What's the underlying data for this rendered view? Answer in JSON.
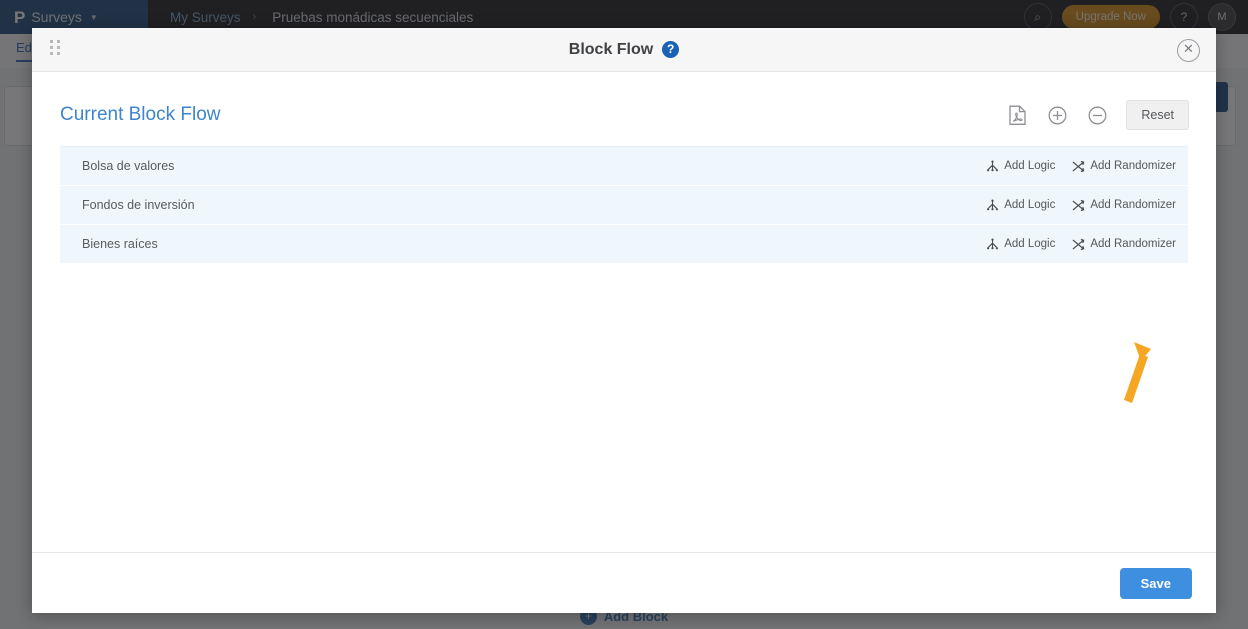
{
  "background": {
    "brand": {
      "logo_glyph": "P",
      "label": "Surveys",
      "caret": "▼"
    },
    "breadcrumb": {
      "parent": "My Surveys",
      "separator": "›",
      "current": "Pruebas monádicas secuenciales"
    },
    "topbar_right": {
      "search_icon": "search-icon",
      "search_glyph": "⌕",
      "upgrade_label": "Upgrade Now",
      "help_glyph": "?",
      "avatar_initial": "M"
    },
    "subtab_label": "Ed",
    "add_block_label": "Add Block",
    "add_block_glyph": "+",
    "accent_blue": "#1f4e86",
    "upgrade_orange": "#d78b10"
  },
  "modal": {
    "header": {
      "title": "Block Flow",
      "help_glyph": "?",
      "close_glyph": "✕",
      "drag_handle_icon": "drag-handle-icon"
    },
    "toolbar": {
      "heading": "Current Block Flow",
      "export_pdf_icon": "pdf-file-icon",
      "zoom_in_icon": "zoom-in-icon",
      "zoom_out_icon": "zoom-out-icon",
      "reset_label": "Reset"
    },
    "blocks": [
      {
        "name": "Bolsa de valores",
        "add_logic_label": "Add Logic",
        "add_randomizer_label": "Add Randomizer"
      },
      {
        "name": "Fondos de inversión",
        "add_logic_label": "Add Logic",
        "add_randomizer_label": "Add Randomizer"
      },
      {
        "name": "Bienes raíces",
        "add_logic_label": "Add Logic",
        "add_randomizer_label": "Add Randomizer"
      }
    ],
    "annotation": {
      "type": "arrow",
      "points_to": "Add Randomizer",
      "color": "#f5a623"
    },
    "footer": {
      "save_label": "Save",
      "save_color": "#3e8fe0"
    }
  }
}
